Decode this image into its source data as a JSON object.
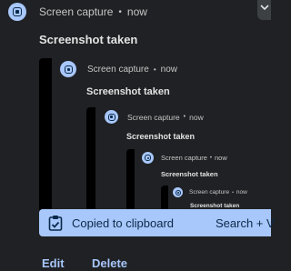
{
  "notification": {
    "app_name": "Screen capture",
    "separator": "•",
    "time": "now",
    "title": "Screenshot taken",
    "icon": "screen-capture-icon"
  },
  "nested_preview": [
    {
      "app_name": "Screen capture",
      "separator": "•",
      "time": "now",
      "title": "Screenshot taken"
    },
    {
      "app_name": "Screen capture",
      "separator": "•",
      "time": "now",
      "title": "Screenshot taken"
    },
    {
      "app_name": "Screen capture",
      "separator": "•",
      "time": "now",
      "title": "Screenshot taken"
    },
    {
      "app_name": "Screen capture",
      "separator": "•",
      "time": "now",
      "title": "Screenshot taken"
    }
  ],
  "clipboard_banner": {
    "message": "Copied to clipboard",
    "shortcut": "Search + V",
    "icon": "clipboard-check-icon"
  },
  "actions": {
    "edit": "Edit",
    "delete": "Delete"
  },
  "colors": {
    "background": "#1f2124",
    "accent": "#a8c7fa",
    "on_accent": "#0b2a4a"
  }
}
